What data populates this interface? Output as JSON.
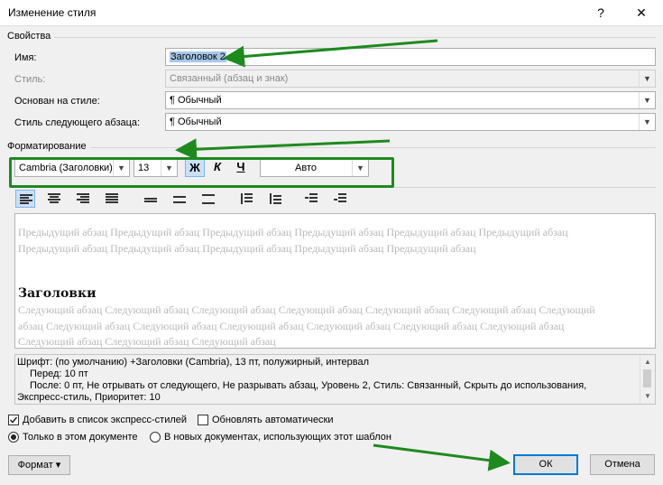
{
  "window": {
    "title": "Изменение стиля",
    "help": "?",
    "close": "✕"
  },
  "properties": {
    "section": "Свойства",
    "name_label": "Имя:",
    "name_value": "Заголовок 2",
    "type_label": "Стиль:",
    "type_value": "Связанный (абзац и знак)",
    "based_label": "Основан на стиле:",
    "based_value": "¶ Обычный",
    "next_label": "Стиль следующего абзаца:",
    "next_value": "¶ Обычный"
  },
  "formatting": {
    "section": "Форматирование",
    "font": "Cambria (Заголовки)",
    "size": "13",
    "bold": "Ж",
    "italic": "К",
    "underline": "Ч",
    "color": "Авто"
  },
  "preview": {
    "prev_para": "Предыдущий абзац Предыдущий абзац Предыдущий абзац Предыдущий абзац Предыдущий абзац Предыдущий абзац Предыдущий абзац Предыдущий абзац Предыдущий абзац Предыдущий абзац Предыдущий абзац",
    "heading": "Заголовки",
    "next_para": "Следующий абзац Следующий абзац Следующий абзац Следующий абзац Следующий абзац Следующий абзац Следующий абзац Следующий абзац Следующий абзац Следующий абзац Следующий абзац Следующий абзац Следующий абзац Следующий абзац Следующий абзац Следующий абзац"
  },
  "description": {
    "line1": "Шрифт: (по умолчанию) +Заголовки (Cambria), 13 пт, полужирный, интервал",
    "line2": "Перед:  10 пт",
    "line3": "После:  0 пт, Не отрывать от следующего, Не разрывать абзац, Уровень 2, Стиль: Связанный, Скрыть до использования,",
    "line4": "Экспресс-стиль, Приоритет: 10"
  },
  "options": {
    "add_quick": "Добавить в список экспресс-стилей",
    "auto_update": "Обновлять автоматически",
    "only_doc": "Только в этом документе",
    "new_docs": "В новых документах, использующих этот шаблон"
  },
  "buttons": {
    "format": "Формат ▾",
    "ok": "ОК",
    "cancel": "Отмена"
  },
  "colors": {
    "annotation": "#1e8a1e",
    "accent": "#0078d7"
  }
}
